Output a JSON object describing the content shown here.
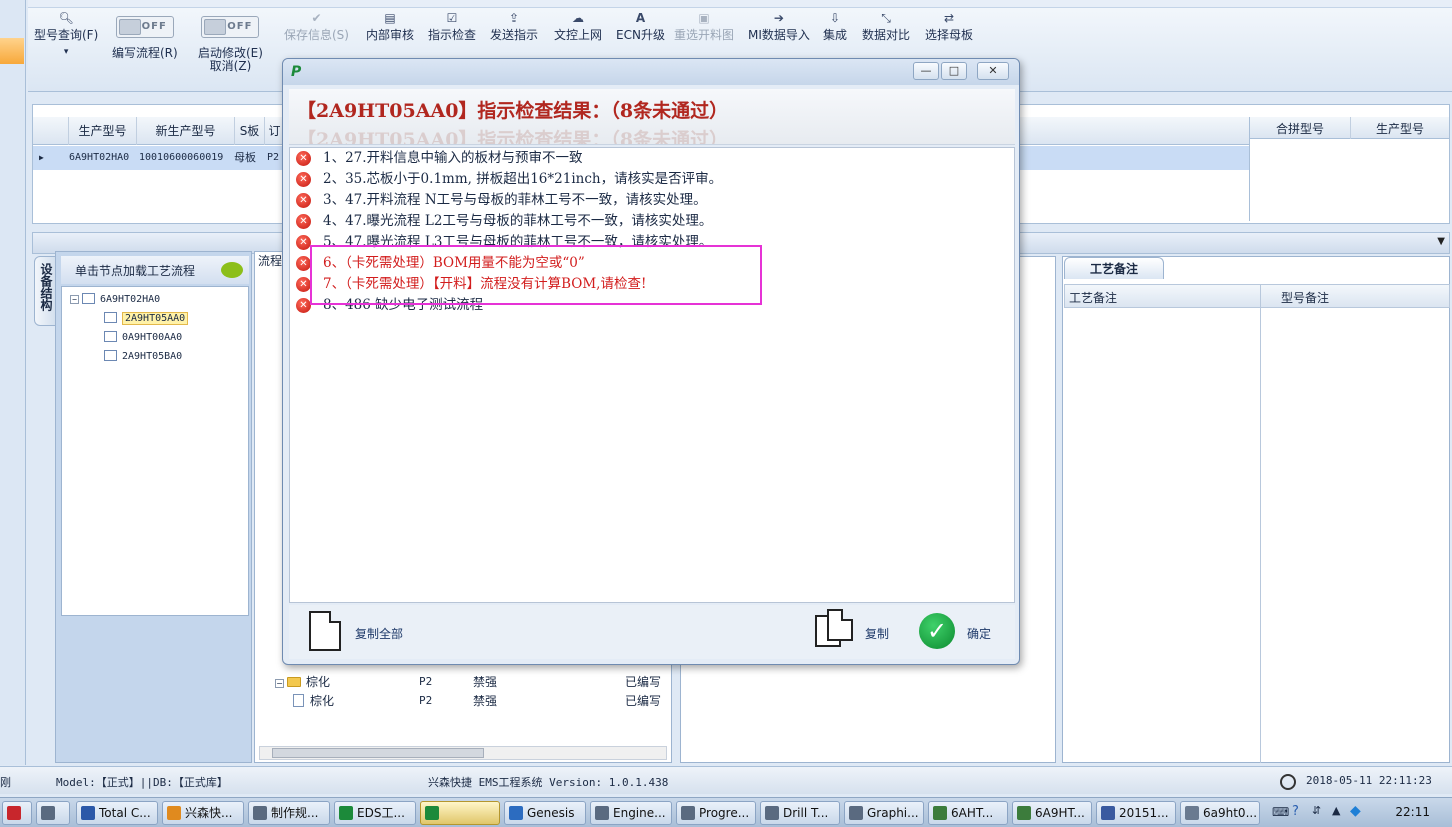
{
  "ribbon": {
    "items": [
      {
        "label": "型号查询(F)",
        "icon": "search-icon",
        "sub": "▾",
        "enabled": true
      },
      {
        "label": "编写流程(R)",
        "toggle": "OFF",
        "enabled": true
      },
      {
        "label": "启动修改(E)",
        "sub": "取消(Z)",
        "toggle": "OFF",
        "enabled": true
      },
      {
        "label": "保存信息(S)",
        "icon": "check-icon",
        "enabled": false
      },
      {
        "label": "内部审核",
        "icon": "print-icon",
        "enabled": true
      },
      {
        "label": "指示检查",
        "icon": "checkbox-icon",
        "enabled": true
      },
      {
        "label": "发送指示",
        "icon": "upload-icon",
        "enabled": true
      },
      {
        "label": "文控上网",
        "icon": "cloud-upload-icon",
        "enabled": true
      },
      {
        "label": "ECN升级",
        "icon": "font-icon",
        "enabled": true
      },
      {
        "label": "重选开料图",
        "icon": "image-icon",
        "enabled": false
      },
      {
        "label": "MI数据导入",
        "icon": "sign-in-icon",
        "enabled": true
      },
      {
        "label": "集成",
        "icon": "download-icon",
        "enabled": true
      },
      {
        "label": "数据对比",
        "icon": "compress-icon",
        "enabled": true
      },
      {
        "label": "选择母板",
        "icon": "shuffle-icon",
        "enabled": true
      }
    ]
  },
  "grid": {
    "columns": [
      "生产型号",
      "新生产型号",
      "S板",
      "订"
    ],
    "row": [
      "6A9HT02HA0",
      "10010600060019",
      "母板",
      "P2"
    ],
    "merge_columns": [
      "合拼型号",
      "生产型号"
    ]
  },
  "tree": {
    "vertical_tab": "设备结构",
    "header": "单击节点加载工艺流程",
    "nodes": [
      {
        "label": "6A9HT02HA0",
        "level": 0,
        "selected": false
      },
      {
        "label": "2A9HT05AA0",
        "level": 1,
        "selected": true
      },
      {
        "label": "0A9HT00AA0",
        "level": 1,
        "selected": false
      },
      {
        "label": "2A9HT05BA0",
        "level": 1,
        "selected": false
      }
    ]
  },
  "process": {
    "header": "流程",
    "rows": [
      {
        "name": "棕化",
        "c1": "P2",
        "c2": "禁强",
        "c3": "已编写",
        "kind": "folder"
      },
      {
        "name": "棕化",
        "c1": "P2",
        "c2": "禁强",
        "c3": "已编写",
        "kind": "doc"
      }
    ]
  },
  "notes": {
    "tab": "工艺备注",
    "columns": [
      "工艺备注",
      "型号备注"
    ]
  },
  "dialog": {
    "title": "【2A9HT05AA0】指示检查结果：（8条未通过）",
    "ghost_title": "【2A9HT05AA0】指示检查结果：（8条未通过）",
    "messages": [
      {
        "text": "1、27.开料信息中输入的板材与预审不一致",
        "red": false
      },
      {
        "text": "2、35.芯板小于0.1mm, 拼板超出16*21inch，请核实是否评审。",
        "red": false
      },
      {
        "text": "3、47.开料流程 N工号与母板的菲林工号不一致，请核实处理。",
        "red": false
      },
      {
        "text": "4、47.曝光流程 L2工号与母板的菲林工号不一致，请核实处理。",
        "red": false
      },
      {
        "text": "5、47.曝光流程 L3工号与母板的菲林工号不一致，请核实处理。",
        "red": false
      },
      {
        "text": "6、（卡死需处理）BOM用量不能为空或“0”",
        "red": true
      },
      {
        "text": "7、（卡死需处理）【开料】流程没有计算BOM,请检查!",
        "red": true
      },
      {
        "text": "8、486 缺少电子测试流程",
        "red": false
      }
    ],
    "copy_all_label": "复制全部",
    "copy_label": "复制",
    "ok_label": "确定",
    "min": "—",
    "max": "□",
    "close": "✕"
  },
  "status": {
    "left": "刚",
    "model": "Model:【正式】||DB:【正式库】",
    "app": "兴森快捷 EMS工程系统 Version: 1.0.1.438",
    "datetime": "2018-05-11 22:11:23"
  },
  "taskbar": {
    "items": [
      {
        "label": "Total C...",
        "color": "#2b58a8"
      },
      {
        "label": "兴森快...",
        "color": "#e08a1e"
      },
      {
        "label": "制作规...",
        "color": "#5a6a80"
      },
      {
        "label": "EDS工...",
        "color": "#1c8a3a"
      },
      {
        "label": "",
        "color": "#1c8a3a",
        "active": true
      },
      {
        "label": "Genesis",
        "color": "#2c6cc0"
      },
      {
        "label": "Engine...",
        "color": "#5a6a80"
      },
      {
        "label": "Progre...",
        "color": "#5a6a80"
      },
      {
        "label": "Drill T...",
        "color": "#5a6a80"
      },
      {
        "label": "Graphi...",
        "color": "#5a6a80"
      },
      {
        "label": "6AHT...",
        "color": "#3c7c3c"
      },
      {
        "label": "6A9HT...",
        "color": "#3c7c3c"
      },
      {
        "label": "20151...",
        "color": "#3a5aa0"
      },
      {
        "label": "6a9ht0...",
        "color": "#6a7a90"
      }
    ],
    "time": "22:11"
  }
}
